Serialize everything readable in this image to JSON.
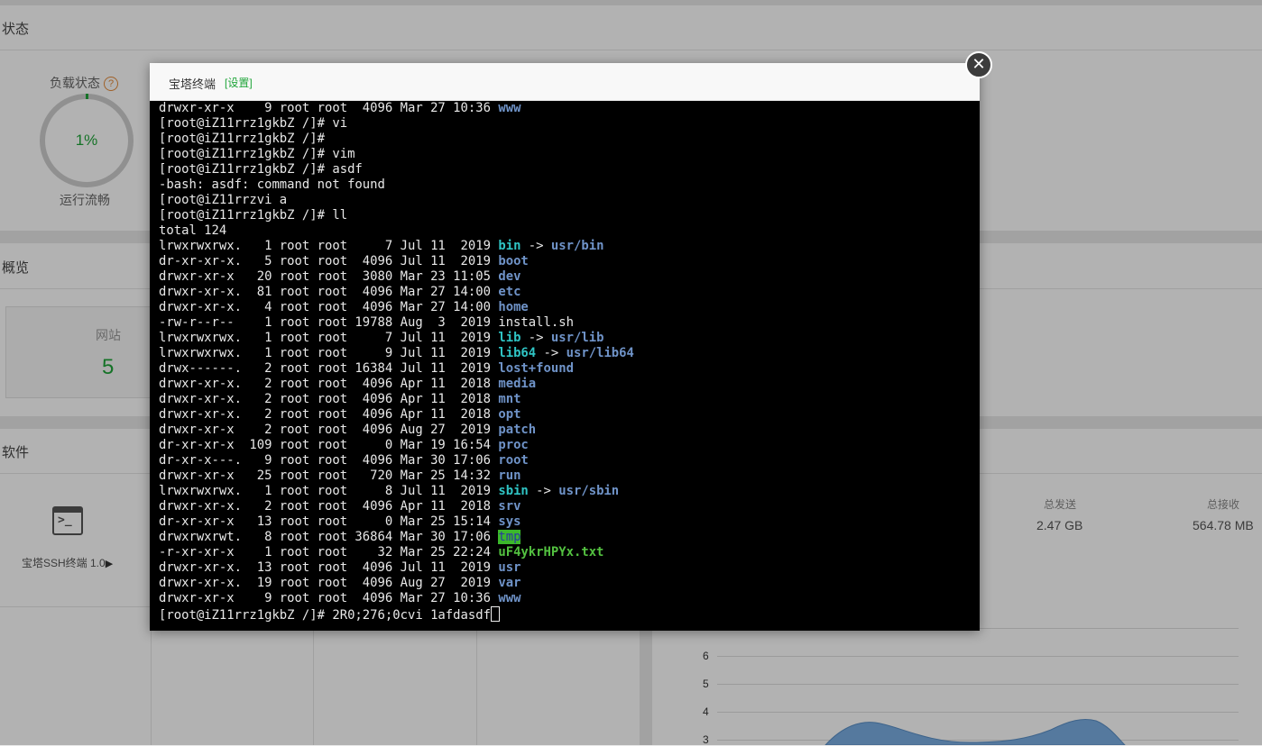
{
  "background": {
    "status_title": "状态",
    "load_label": "负载状态",
    "load_help": "?",
    "load_value": "1%",
    "load_status": "运行流畅",
    "overview_title": "概览",
    "site_label": "网站",
    "site_count": "5",
    "software_title": "软件",
    "ssh_label": "宝塔SSH终端 1.0",
    "total_sent_label": "总发送",
    "total_sent_value": "2.47 GB",
    "total_recv_label": "总接收",
    "total_recv_value": "564.78 MB",
    "chart_y_ticks": [
      "6",
      "5",
      "4",
      "3"
    ],
    "chart_color": "#7aaee3"
  },
  "modal": {
    "title": "宝塔终端",
    "settings": "[设置]",
    "close_icon": "close-icon"
  },
  "terminal": {
    "colors": {
      "dir": "#6f93c8",
      "link": "#2fc4c4",
      "exe": "#53c140",
      "tmp_bg": "#3bb82b"
    },
    "lines": [
      [
        {
          "t": "drwxr-xr-x    9 root root  4096 Mar 27 10:36 "
        },
        {
          "t": "www",
          "c": "c-dir"
        }
      ],
      [
        {
          "t": "[root@iZ11rrz1gkbZ /]# vi"
        }
      ],
      [
        {
          "t": "[root@iZ11rrz1gkbZ /]#"
        }
      ],
      [
        {
          "t": "[root@iZ11rrz1gkbZ /]# vim"
        }
      ],
      [
        {
          "t": "[root@iZ11rrz1gkbZ /]# asdf"
        }
      ],
      [
        {
          "t": "-bash: asdf: command not found"
        }
      ],
      [
        {
          "t": "[root@iZ11rrzvi a"
        }
      ],
      [
        {
          "t": "[root@iZ11rrz1gkbZ /]# ll"
        }
      ],
      [
        {
          "t": "total 124"
        }
      ],
      [
        {
          "t": "lrwxrwxrwx.   1 root root     7 Jul 11  2019 "
        },
        {
          "t": "bin",
          "c": "c-link"
        },
        {
          "t": " -> "
        },
        {
          "t": "usr/bin",
          "c": "c-dir"
        }
      ],
      [
        {
          "t": "dr-xr-xr-x.   5 root root  4096 Jul 11  2019 "
        },
        {
          "t": "boot",
          "c": "c-dir"
        }
      ],
      [
        {
          "t": "drwxr-xr-x   20 root root  3080 Mar 23 11:05 "
        },
        {
          "t": "dev",
          "c": "c-dir"
        }
      ],
      [
        {
          "t": "drwxr-xr-x.  81 root root  4096 Mar 27 14:00 "
        },
        {
          "t": "etc",
          "c": "c-dir"
        }
      ],
      [
        {
          "t": "drwxr-xr-x.   4 root root  4096 Mar 27 14:00 "
        },
        {
          "t": "home",
          "c": "c-dir"
        }
      ],
      [
        {
          "t": "-rw-r--r--    1 root root 19788 Aug  3  2019 install.sh"
        }
      ],
      [
        {
          "t": "lrwxrwxrwx.   1 root root     7 Jul 11  2019 "
        },
        {
          "t": "lib",
          "c": "c-link"
        },
        {
          "t": " -> "
        },
        {
          "t": "usr/lib",
          "c": "c-dir"
        }
      ],
      [
        {
          "t": "lrwxrwxrwx.   1 root root     9 Jul 11  2019 "
        },
        {
          "t": "lib64",
          "c": "c-link"
        },
        {
          "t": " -> "
        },
        {
          "t": "usr/lib64",
          "c": "c-dir"
        }
      ],
      [
        {
          "t": "drwx------.   2 root root 16384 Jul 11  2019 "
        },
        {
          "t": "lost+found",
          "c": "c-dir"
        }
      ],
      [
        {
          "t": "drwxr-xr-x.   2 root root  4096 Apr 11  2018 "
        },
        {
          "t": "media",
          "c": "c-dir"
        }
      ],
      [
        {
          "t": "drwxr-xr-x.   2 root root  4096 Apr 11  2018 "
        },
        {
          "t": "mnt",
          "c": "c-dir"
        }
      ],
      [
        {
          "t": "drwxr-xr-x.   2 root root  4096 Apr 11  2018 "
        },
        {
          "t": "opt",
          "c": "c-dir"
        }
      ],
      [
        {
          "t": "drwxr-xr-x    2 root root  4096 Aug 27  2019 "
        },
        {
          "t": "patch",
          "c": "c-dir"
        }
      ],
      [
        {
          "t": "dr-xr-xr-x  109 root root     0 Mar 19 16:54 "
        },
        {
          "t": "proc",
          "c": "c-dir"
        }
      ],
      [
        {
          "t": "dr-xr-x---.   9 root root  4096 Mar 30 17:06 "
        },
        {
          "t": "root",
          "c": "c-dir"
        }
      ],
      [
        {
          "t": "drwxr-xr-x   25 root root   720 Mar 25 14:32 "
        },
        {
          "t": "run",
          "c": "c-dir"
        }
      ],
      [
        {
          "t": "lrwxrwxrwx.   1 root root     8 Jul 11  2019 "
        },
        {
          "t": "sbin",
          "c": "c-link"
        },
        {
          "t": " -> "
        },
        {
          "t": "usr/sbin",
          "c": "c-dir"
        }
      ],
      [
        {
          "t": "drwxr-xr-x.   2 root root  4096 Apr 11  2018 "
        },
        {
          "t": "srv",
          "c": "c-dir"
        }
      ],
      [
        {
          "t": "dr-xr-xr-x   13 root root     0 Mar 25 15:14 "
        },
        {
          "t": "sys",
          "c": "c-dir"
        }
      ],
      [
        {
          "t": "drwxrwxrwt.   8 root root 36864 Mar 30 17:06 "
        },
        {
          "t": "tmp",
          "c": "c-tmp"
        }
      ],
      [
        {
          "t": "-r-xr-xr-x    1 root root    32 Mar 25 22:24 "
        },
        {
          "t": "uF4ykrHPYx.txt",
          "c": "c-exe"
        }
      ],
      [
        {
          "t": "drwxr-xr-x.  13 root root  4096 Jul 11  2019 "
        },
        {
          "t": "usr",
          "c": "c-dir"
        }
      ],
      [
        {
          "t": "drwxr-xr-x.  19 root root  4096 Aug 27  2019 "
        },
        {
          "t": "var",
          "c": "c-dir"
        }
      ],
      [
        {
          "t": "drwxr-xr-x    9 root root  4096 Mar 27 10:36 "
        },
        {
          "t": "www",
          "c": "c-dir"
        }
      ],
      [
        {
          "t": "[root@iZ11rrz1gkbZ /]# 2R0;276;0cvi 1afdasdf"
        }
      ]
    ]
  }
}
